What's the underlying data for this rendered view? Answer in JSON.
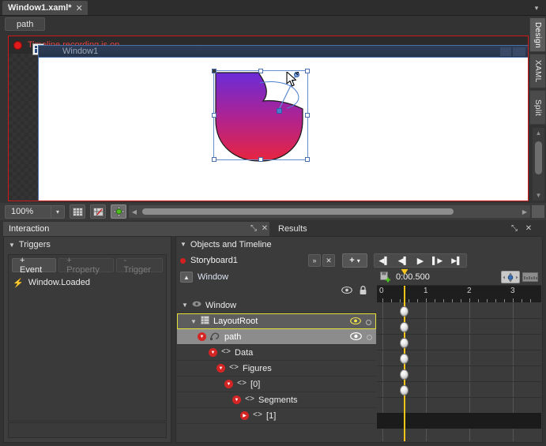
{
  "app": {
    "accent_red": "#d01a1a",
    "accent_yellow": "#f5c518",
    "selection_blue": "#4a7fd0"
  },
  "tabstrip": {
    "document_tab": "Window1.xaml*",
    "close_glyph": "✕",
    "overflow_glyph": "▾"
  },
  "breadcrumb": {
    "path_label": "path"
  },
  "artboard": {
    "recording_label": "Timeline recording is on",
    "window_title": "Window1",
    "gradient_top": "#6a2bd8",
    "gradient_mid": "#b0238f",
    "gradient_bottom": "#e8253f"
  },
  "view_tabs": [
    {
      "label": "Design",
      "active": true
    },
    {
      "label": "XAML",
      "active": false
    },
    {
      "label": "Split",
      "active": false
    }
  ],
  "zoom_toolbar": {
    "zoom_value": "100%",
    "chevron_glyph": "▾",
    "grid_icon": "grid-icon",
    "snap_icon": "snap-to-gridlines-icon",
    "move_icon": "show-handles-icon"
  },
  "panel_tabs": {
    "selected": "Interaction",
    "other": "Results",
    "float_glyph": "⤡",
    "close_glyph": "✕"
  },
  "interaction": {
    "section_title": "Triggers",
    "buttons": [
      {
        "label": "+ Event",
        "enabled": true
      },
      {
        "label": "+ Property",
        "enabled": false
      },
      {
        "label": "- Trigger",
        "enabled": false
      }
    ],
    "trigger_items": [
      {
        "label": "Window.Loaded",
        "icon": "bolt-icon"
      }
    ]
  },
  "objects_timeline": {
    "panel_title": "Objects and Timeline",
    "storyboard_name": "Storyboard1",
    "storyboard_buttons": [
      {
        "name": "close-storyboard-button",
        "glyph": "»"
      },
      {
        "name": "delete-storyboard-button",
        "glyph": "✕"
      }
    ],
    "new_button": {
      "label": "+",
      "chevron": "▾"
    },
    "transport": [
      {
        "name": "go-to-first-frame-button",
        "glyph": "◀❘"
      },
      {
        "name": "previous-frame-button",
        "glyph": "◀❘"
      },
      {
        "name": "play-button",
        "glyph": "▶"
      },
      {
        "name": "next-frame-button",
        "glyph": "❘▶"
      },
      {
        "name": "go-to-last-frame-button",
        "glyph": "▶❘"
      }
    ],
    "breadcrumb_scope": "Window",
    "tree": [
      {
        "label": "Window",
        "depth": 0,
        "icon": "window-icon",
        "caret": "down",
        "state": "normal",
        "eye": true,
        "lock": false
      },
      {
        "label": "LayoutRoot",
        "depth": 1,
        "icon": "grid-icon",
        "caret": "down",
        "state": "selected",
        "eye": true,
        "lock": false
      },
      {
        "label": "path",
        "depth": 2,
        "icon": "path-icon",
        "caret": "down-red",
        "state": "highlight",
        "eye": true,
        "lock": false
      },
      {
        "label": "Data",
        "depth": 3,
        "icon": "xaml-icon",
        "caret": "down-red",
        "state": "normal",
        "eye": false,
        "lock": false
      },
      {
        "label": "Figures",
        "depth": 4,
        "icon": "xaml-icon",
        "caret": "down-red",
        "state": "normal",
        "eye": false,
        "lock": false
      },
      {
        "label": "[0]",
        "depth": 5,
        "icon": "xaml-icon",
        "caret": "down-red",
        "state": "normal",
        "eye": false,
        "lock": false
      },
      {
        "label": "Segments",
        "depth": 6,
        "icon": "xaml-icon",
        "caret": "down-red",
        "state": "normal",
        "eye": false,
        "lock": false
      },
      {
        "label": "[1]",
        "depth": 7,
        "icon": "xaml-icon",
        "caret": "right-red",
        "state": "normal",
        "eye": false,
        "lock": false
      }
    ]
  },
  "timeline": {
    "current_time": "0:00.500",
    "snap_icon": "snap-resolution-icon",
    "ruler_icon": "timeline-zoom-icon",
    "ruler_ticks": [
      "0",
      "1",
      "2",
      "3"
    ],
    "playhead_time": 0.5,
    "keyframe_rows": 6
  }
}
